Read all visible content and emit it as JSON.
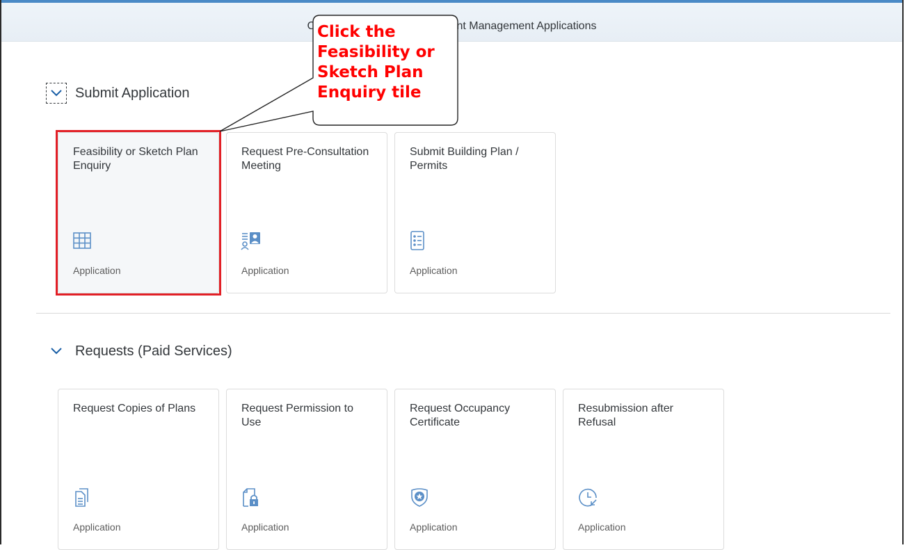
{
  "header": {
    "title": "City of Cape Town Development Management Applications"
  },
  "callout": {
    "lines": [
      "Click the",
      "Feasibility or",
      "Sketch Plan",
      "Enquiry tile"
    ]
  },
  "sections": [
    {
      "title": "Submit Application",
      "tiles": [
        {
          "title": "Feasibility or Sketch Plan Enquiry",
          "subtitle": "Application",
          "icon": "grid-table-icon"
        },
        {
          "title": "Request Pre-Consultation Meeting",
          "subtitle": "Application",
          "icon": "contact-card-icon"
        },
        {
          "title": "Submit Building Plan / Permits",
          "subtitle": "Application",
          "icon": "checklist-icon"
        }
      ]
    },
    {
      "title": "Requests (Paid Services)",
      "tiles": [
        {
          "title": "Request Copies of Plans",
          "subtitle": "Application",
          "icon": "copy-documents-icon"
        },
        {
          "title": "Request Permission to Use",
          "subtitle": "Application",
          "icon": "locked-document-icon"
        },
        {
          "title": "Request Occupancy Certificate",
          "subtitle": "Application",
          "icon": "badge-shield-icon"
        },
        {
          "title": "Resubmission after Refusal",
          "subtitle": "Application",
          "icon": "clock-return-icon"
        }
      ]
    }
  ],
  "colors": {
    "accent": "#4a8ac6",
    "icon": "#5b8fc7",
    "highlight": "#e21f26",
    "callout_text": "#ff0000"
  }
}
